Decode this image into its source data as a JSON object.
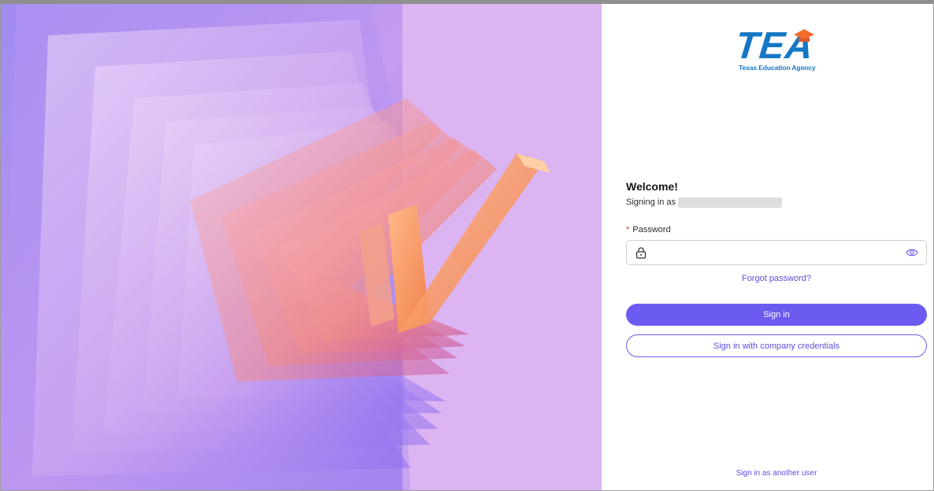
{
  "logo": {
    "mark": "TEA",
    "subtitle": "Texas Education Agency"
  },
  "login": {
    "welcome": "Welcome!",
    "signing_in_as": "Signing in as",
    "password_label": "Password",
    "required_marker": "*",
    "password_value": "",
    "forgot_link": "Forgot password?",
    "sign_in_button": "Sign in",
    "company_credentials_button": "Sign in with company credentials",
    "another_user_link": "Sign in as another user"
  },
  "icons": {
    "lock": "lock-icon",
    "eye": "eye-icon"
  },
  "colors": {
    "accent": "#6b5bf1",
    "link": "#5b4fe0",
    "brand_blue": "#1577c6",
    "brand_orange": "#f26b2d",
    "hero_background": "#dcb4f1",
    "required": "#d14343"
  }
}
